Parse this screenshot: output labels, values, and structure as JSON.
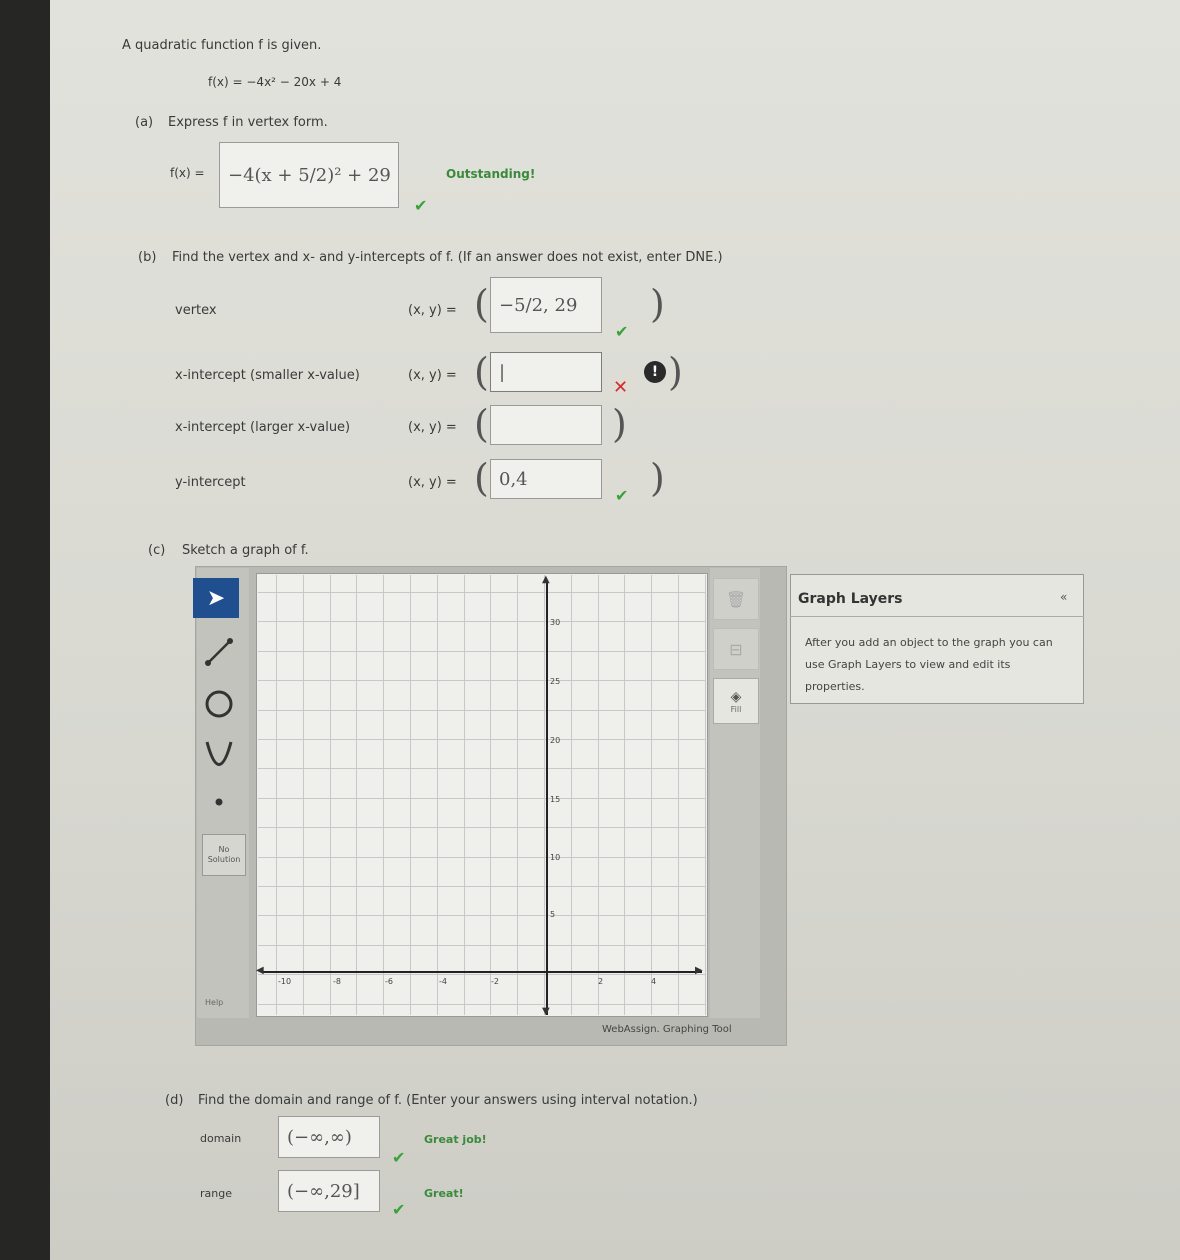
{
  "problem": {
    "intro": "A quadratic function f is given.",
    "function": "f(x) = −4x² − 20x + 4"
  },
  "part_a": {
    "label": "(a)",
    "prompt": "Express f in vertex form.",
    "lhs": "f(x) =",
    "answer": "−4(x + 5/2)² + 29",
    "feedback": "Outstanding!"
  },
  "part_b": {
    "label": "(b)",
    "prompt": "Find the vertex and x- and y-intercepts of f. (If an answer does not exist, enter DNE.)",
    "rows": [
      {
        "label": "vertex",
        "eq": "(x, y) =",
        "value": "−5/2, 29",
        "status": "correct"
      },
      {
        "label": "x-intercept (smaller x-value)",
        "eq": "(x, y) =",
        "value": "|",
        "status": "incorrect"
      },
      {
        "label": "x-intercept (larger x-value)",
        "eq": "(x, y) =",
        "value": "",
        "status": "none"
      },
      {
        "label": "y-intercept",
        "eq": "(x, y) =",
        "value": "0,4",
        "status": "correct"
      }
    ]
  },
  "part_c": {
    "label": "(c)",
    "prompt": "Sketch a graph of f.",
    "tools": [
      "pointer-tool",
      "line-tool",
      "circle-tool",
      "parabola-tool",
      "point-tool"
    ],
    "no_solution_label": "No Solution",
    "help_label": "Help",
    "fill_label": "Fill",
    "y_ticks": [
      "30",
      "25",
      "20",
      "15",
      "10",
      "5"
    ],
    "x_ticks": [
      "-10",
      "-8",
      "-6",
      "-4",
      "-2",
      "2",
      "4"
    ],
    "footer": "WebAssign. Graphing Tool",
    "layers": {
      "title": "Graph Layers",
      "collapse": "«",
      "body": "After you add an object to the graph you can use Graph Layers to view and edit its properties."
    }
  },
  "part_d": {
    "label": "(d)",
    "prompt": "Find the domain and range of f. (Enter your answers using interval notation.)",
    "domain_label": "domain",
    "domain_value": "(−∞,∞)",
    "domain_feedback": "Great job!",
    "range_label": "range",
    "range_value": "(−∞,29]",
    "range_feedback": "Great!"
  },
  "colors": {
    "correct": "#3aa23a",
    "incorrect": "#d42b2b",
    "toolbar_active": "#1f4f8f"
  }
}
